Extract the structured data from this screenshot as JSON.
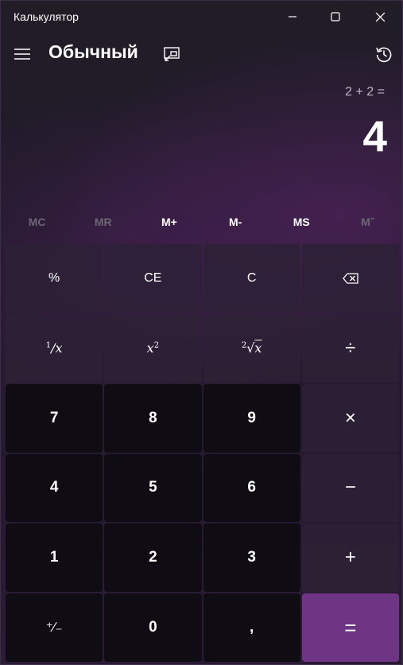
{
  "titlebar": {
    "app_title": "Калькулятор"
  },
  "header": {
    "mode_title": "Обычный"
  },
  "display": {
    "expression": "2 + 2 =",
    "result": "4"
  },
  "memory": [
    {
      "label": "MC",
      "enabled": false
    },
    {
      "label": "MR",
      "enabled": false
    },
    {
      "label": "M+",
      "enabled": true
    },
    {
      "label": "M-",
      "enabled": true
    },
    {
      "label": "MS",
      "enabled": true
    },
    {
      "label": "Mˇ",
      "enabled": false
    }
  ],
  "keys": {
    "percent": "%",
    "ce": "CE",
    "c": "C",
    "reciprocal_num": "1",
    "reciprocal_var": "x",
    "square_var": "x",
    "square_pow": "2",
    "sqrt_index": "2",
    "sqrt_var": "x",
    "divide": "÷",
    "seven": "7",
    "eight": "8",
    "nine": "9",
    "multiply": "×",
    "four": "4",
    "five": "5",
    "six": "6",
    "minus": "−",
    "one": "1",
    "two": "2",
    "three": "3",
    "plus": "+",
    "negate": "⁺∕₋",
    "zero": "0",
    "decimal": ",",
    "equals": "="
  },
  "colors": {
    "equals_bg": "#6e3585",
    "number_key_bg": "#0f0c13",
    "function_key_bg": "#2d2136",
    "disabled_text": "#6e6676"
  },
  "icons": [
    "minimize-icon",
    "maximize-icon",
    "close-icon",
    "hamburger-icon",
    "keep-on-top-icon",
    "history-icon",
    "backspace-icon"
  ]
}
